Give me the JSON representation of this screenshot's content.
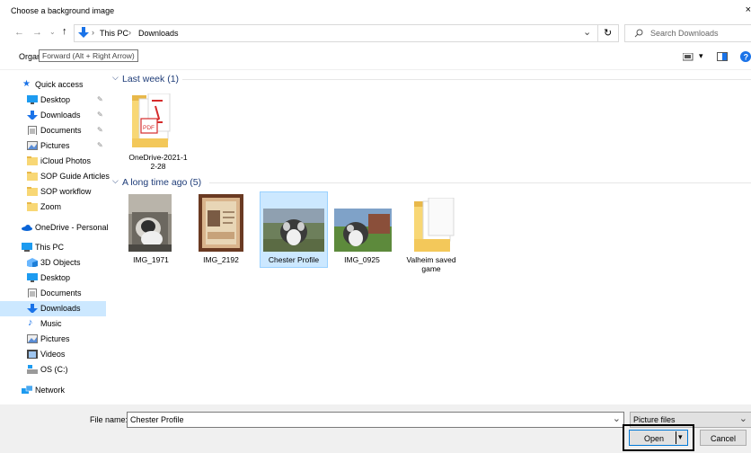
{
  "window": {
    "title": "Choose a background image",
    "close": "×"
  },
  "address": {
    "crumbs": [
      "This PC",
      "Downloads"
    ],
    "separator": "›",
    "search_placeholder": "Search Downloads"
  },
  "toolbar": {
    "organize": "Organ",
    "tooltip": "Forward (Alt + Right Arrow)"
  },
  "nav": {
    "quick_access": "Quick access",
    "quick_items": [
      "Desktop",
      "Downloads",
      "Documents",
      "Pictures",
      "iCloud Photos",
      "SOP Guide Articles",
      "SOP workflow",
      "Zoom"
    ],
    "onedrive": "OneDrive - Personal",
    "this_pc": "This PC",
    "pc_items": [
      "3D Objects",
      "Desktop",
      "Documents",
      "Downloads",
      "Music",
      "Pictures",
      "Videos",
      "OS (C:)"
    ],
    "network": "Network"
  },
  "groups": [
    {
      "label": "Last week (1)",
      "items": [
        {
          "name_l1": "OneDrive-2021-1",
          "name_l2": "2-28"
        }
      ]
    },
    {
      "label": "A long time ago (5)",
      "items": [
        {
          "name": "IMG_1971"
        },
        {
          "name": "IMG_2192"
        },
        {
          "name": "Chester Profile"
        },
        {
          "name": "IMG_0925"
        },
        {
          "name_l1": "Valheim saved",
          "name_l2": "game"
        }
      ]
    }
  ],
  "bottom": {
    "file_name_label": "File name:",
    "file_name_value": "Chester Profile",
    "filter": "Picture files",
    "open": "Open",
    "cancel": "Cancel"
  },
  "colors": {
    "selection": "#cce8ff",
    "accent": "#0078d7",
    "folder": "#f8d775",
    "header_text": "#1e3c78"
  }
}
